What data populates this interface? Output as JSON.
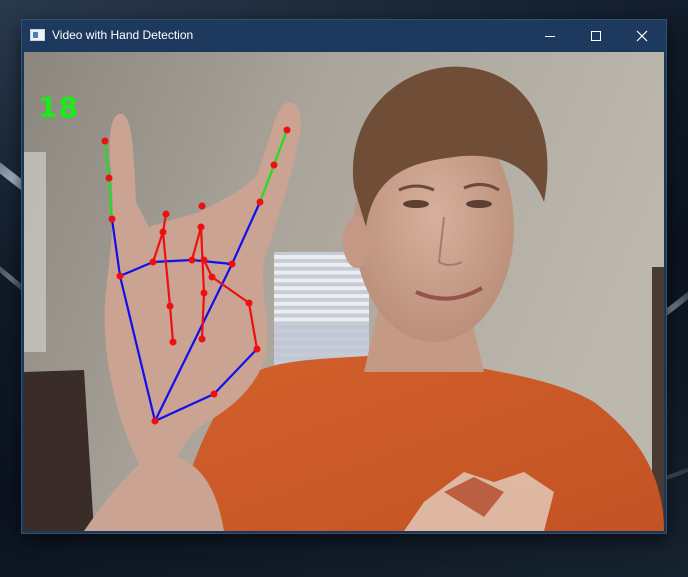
{
  "window": {
    "title": "Video with Hand Detection",
    "controls": {
      "minimize_icon": "minimize-icon",
      "maximize_icon": "maximize-icon",
      "close_icon": "close-icon"
    }
  },
  "overlay": {
    "counter_text": "18",
    "colors": {
      "counter": "#16ee16",
      "thumb_pinky_segments": "#22dd22",
      "palm_segments": "#1010ee",
      "middle_ring_segments": "#ee1010",
      "landmarks": "#ee1010"
    }
  },
  "scene": {
    "subject": "person in orange t-shirt making hand sign",
    "colors": {
      "wall": "#a7a196",
      "shirt": "#d9642e",
      "skin": "#cfa996",
      "hair": "#6f4d36",
      "blinds": "#d6dbe6"
    }
  }
}
